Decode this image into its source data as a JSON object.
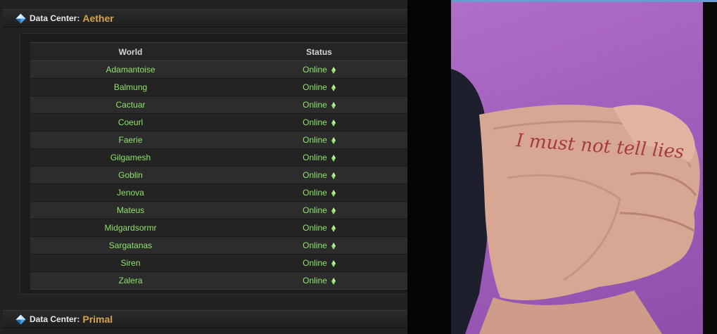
{
  "data_centers": [
    {
      "label": "Data Center:",
      "name": "Aether",
      "columns": {
        "world": "World",
        "status": "Status"
      },
      "worlds": [
        {
          "name": "Adamantoise",
          "status": "Online"
        },
        {
          "name": "Balmung",
          "status": "Online"
        },
        {
          "name": "Cactuar",
          "status": "Online"
        },
        {
          "name": "Coeurl",
          "status": "Online"
        },
        {
          "name": "Faerie",
          "status": "Online"
        },
        {
          "name": "Gilgamesh",
          "status": "Online"
        },
        {
          "name": "Goblin",
          "status": "Online"
        },
        {
          "name": "Jenova",
          "status": "Online"
        },
        {
          "name": "Mateus",
          "status": "Online"
        },
        {
          "name": "Midgardsormr",
          "status": "Online"
        },
        {
          "name": "Sargatanas",
          "status": "Online"
        },
        {
          "name": "Siren",
          "status": "Online"
        },
        {
          "name": "Zalera",
          "status": "Online"
        }
      ]
    },
    {
      "label": "Data Center:",
      "name": "Primal"
    }
  ],
  "photo": {
    "handwritten_text": "I must not tell lies"
  },
  "colors": {
    "online": "#8fe36a",
    "accent_gold": "#d7a34d",
    "photo_background": "#a35fbd"
  },
  "icons": {
    "data_center": "blue-crystal-icon",
    "status": "green-diamond-icon"
  }
}
